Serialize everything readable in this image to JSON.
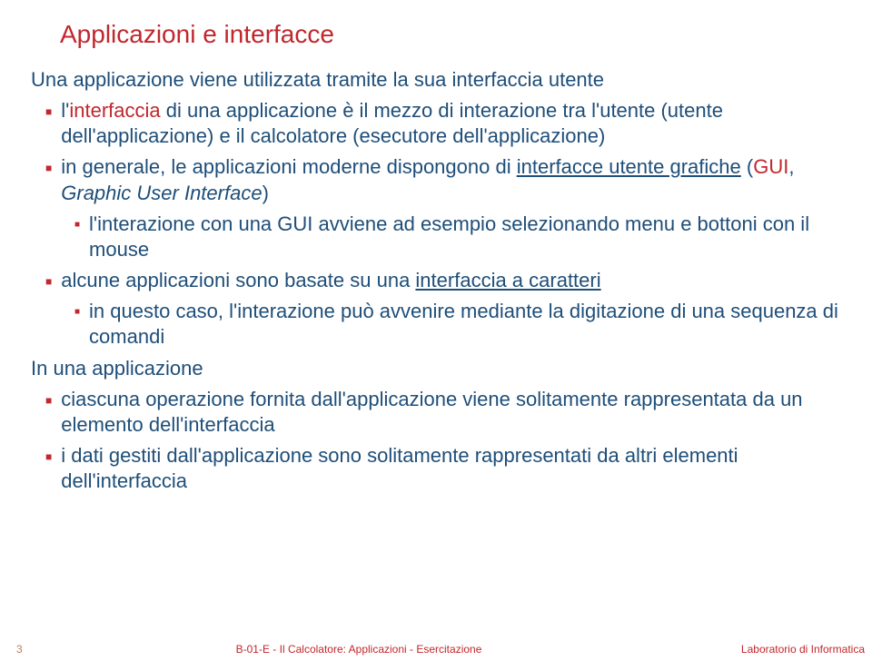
{
  "title": "Applicazioni e interfacce",
  "intro": "Una applicazione viene utilizzata tramite la sua interfaccia utente",
  "b1_a": "l'",
  "b1_b": "interfaccia",
  "b1_c": " di una applicazione è il mezzo di interazione tra l'utente (utente dell'applicazione) e il calcolatore (esecutore dell'applicazione)",
  "b2_a": "in generale, le applicazioni moderne dispongono di ",
  "b2_b": "interfacce utente grafiche",
  "b2_c": " (",
  "b2_d": "GUI",
  "b2_e": ", ",
  "b2_f": "Graphic User Interface",
  "b2_g": ")",
  "b2s1": "l'interazione con una GUI avviene ad esempio selezionando menu e bottoni con il mouse",
  "b3_a": "alcune applicazioni sono basate su una ",
  "b3_b": "interfaccia a caratteri",
  "b3s1": "in questo caso, l'interazione può avvenire mediante la digitazione di una sequenza di comandi",
  "mid": "In una applicazione",
  "b4": "ciascuna operazione fornita dall'applicazione viene solitamente rappresentata da un elemento dell'interfaccia",
  "b5": "i dati gestiti dall'applicazione sono solitamente rappresentati da altri elementi dell'interfaccia",
  "footer_page": "3",
  "footer_center": "B-01-E - Il Calcolatore: Applicazioni - Esercitazione",
  "footer_right": "Laboratorio di Informatica"
}
